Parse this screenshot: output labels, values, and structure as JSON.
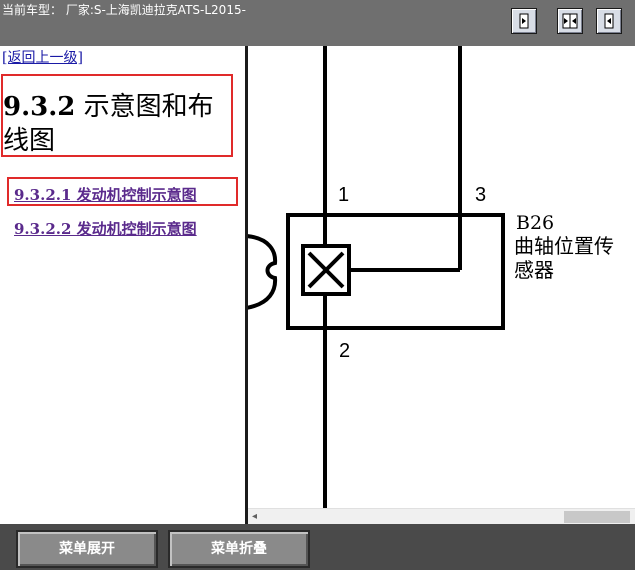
{
  "header": {
    "vehicle_label": "当前车型： 厂家:S-上海凯迪拉克ATS-L2015-"
  },
  "toolbar": {
    "buttons": [
      "layout-left-icon",
      "layout-split-icon",
      "layout-right-icon"
    ]
  },
  "nav": {
    "back_link": "[返回上一级]",
    "section_number": "9.3.2",
    "section_title": " 示意图和布线图",
    "items": [
      {
        "label": "9.3.2.1 发动机控制示意图"
      },
      {
        "label": "9.3.2.2 发动机控制示意图"
      }
    ]
  },
  "diagram": {
    "pin_1": "1",
    "pin_2": "2",
    "pin_3": "3",
    "component_id": "B26",
    "component_name_line1": "曲轴位置传",
    "component_name_line2": "感器"
  },
  "footer": {
    "expand_label": "菜单展开",
    "collapse_label": "菜单折叠"
  },
  "colors": {
    "highlight_border": "#e02a2a",
    "link_visited": "#5a2a8c",
    "link": "#1a1aa6"
  }
}
